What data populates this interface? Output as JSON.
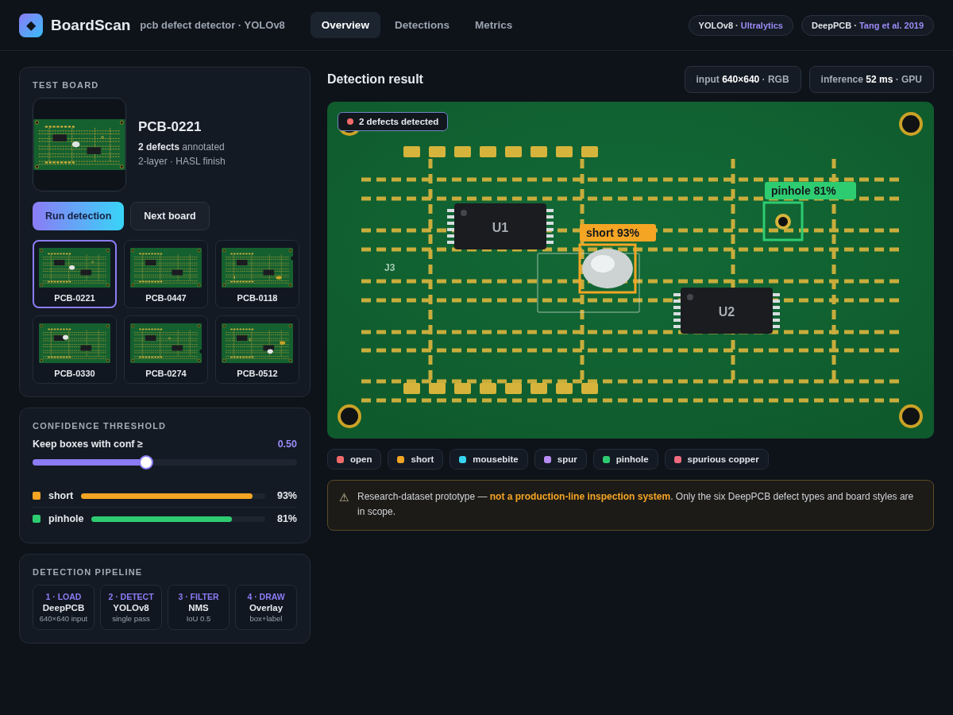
{
  "header": {
    "logo": "◆",
    "title": "BoardScan",
    "subtitle": "pcb defect detector · YOLOv8",
    "tabs": [
      {
        "label": "Overview",
        "selected": true
      },
      {
        "label": "Detections",
        "selected": false
      },
      {
        "label": "Metrics",
        "selected": false
      }
    ],
    "tags": [
      {
        "text": "YOLOv8 ·",
        "link": "Ultralytics"
      },
      {
        "text": "DeepPCB ·",
        "link": "Tang et al. 2019"
      }
    ]
  },
  "test_board": {
    "heading": "TEST BOARD",
    "name": "PCB-0221",
    "defects": "**2 defects** annotated",
    "spec": "2-layer · HASL finish",
    "buttons": [
      {
        "label": "Run detection",
        "kind": "primary"
      },
      {
        "label": "Next board",
        "kind": "secondary"
      }
    ],
    "boards": [
      {
        "label": "PCB-0221",
        "selected": true
      },
      {
        "label": "PCB-0447",
        "selected": false
      },
      {
        "label": "PCB-0118",
        "selected": false
      },
      {
        "label": "PCB-0330",
        "selected": false
      },
      {
        "label": "PCB-0274",
        "selected": false
      },
      {
        "label": "PCB-0512",
        "selected": false
      }
    ]
  },
  "threshold": {
    "heading": "CONFIDENCE THRESHOLD",
    "label": "Keep boxes with conf ≥",
    "value": "0.50",
    "level": 0.43,
    "classes": [
      {
        "name": "short",
        "reading": "93%",
        "level": 0.93,
        "color": "#f5a524"
      },
      {
        "name": "pinhole",
        "reading": "81%",
        "level": 0.81,
        "color": "#2ecc71"
      }
    ]
  },
  "pipeline": {
    "heading": "DETECTION PIPELINE",
    "steps": [
      {
        "step": "1 · LOAD",
        "name": "DeepPCB",
        "detail": "640×640 input"
      },
      {
        "step": "2 · DETECT",
        "name": "YOLOv8",
        "detail": "single pass"
      },
      {
        "step": "3 · FILTER",
        "name": "NMS",
        "detail": "IoU 0.5"
      },
      {
        "step": "4 · DRAW",
        "name": "Overlay",
        "detail": "box+label"
      }
    ]
  },
  "result": {
    "title": "Detection result",
    "stats": [
      "input **640×640** · RGB",
      "inference **52 ms** · GPU"
    ],
    "badge": "2 defects detected",
    "chips": [
      "U1",
      "U2"
    ],
    "connector": "J3",
    "detections": [
      {
        "label": "short 93%",
        "color": "#f5a524"
      },
      {
        "label": "pinhole 81%",
        "color": "#2ecc71"
      }
    ],
    "legend": [
      {
        "name": "open",
        "color": "#f26b6b"
      },
      {
        "name": "short",
        "color": "#f5a524"
      },
      {
        "name": "mousebite",
        "color": "#38d4f0"
      },
      {
        "name": "spur",
        "color": "#b98cf5"
      },
      {
        "name": "pinhole",
        "color": "#2ecc71"
      },
      {
        "name": "spurious copper",
        "color": "#f06a7e"
      }
    ],
    "notice": {
      "icon": "⚠",
      "text": "Research-dataset prototype — **not a production-line inspection system**. Only the six DeepPCB defect types and board styles are in scope."
    }
  }
}
